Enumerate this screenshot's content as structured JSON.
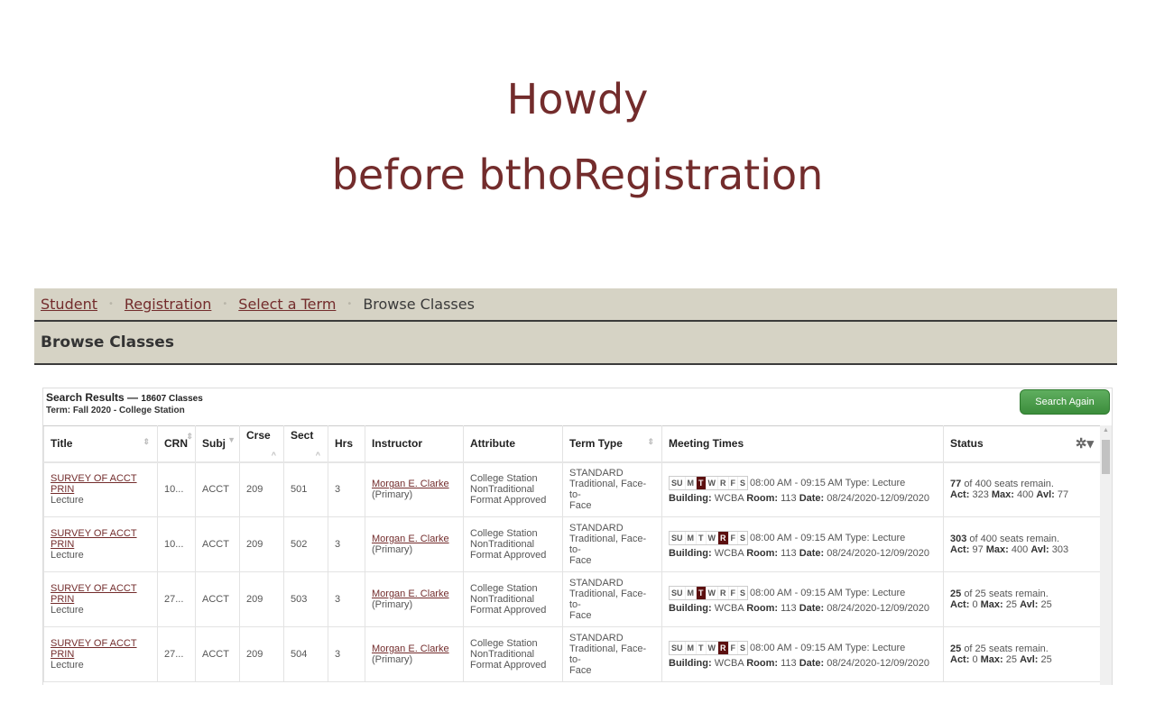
{
  "slide": {
    "line1": "Howdy",
    "line2": "before bthoRegistration"
  },
  "breadcrumb": {
    "items": [
      "Student",
      "Registration",
      "Select a Term"
    ],
    "current": "Browse Classes",
    "separator": "•"
  },
  "page_title": "Browse Classes",
  "results": {
    "title": "Search Results —",
    "count": "18607 Classes",
    "term": "Term: Fall 2020 - College Station",
    "search_again_label": "Search Again",
    "columns": [
      "Title",
      "CRN",
      "Subj",
      "Crse",
      "Sect",
      "Hrs",
      "Instructor",
      "Attribute",
      "Term Type",
      "Meeting Times",
      "Status"
    ],
    "settings_icon": "gear-icon",
    "rows": [
      {
        "title": "SURVEY OF ACCT PRIN",
        "schedule_type": "Lecture",
        "crn": "10...",
        "subj": "ACCT",
        "crse": "209",
        "sect": "501",
        "hrs": "3",
        "instructor": "Morgan E. Clarke",
        "instructor_role": "(Primary)",
        "attribute": [
          "College Station",
          "NonTraditional",
          "Format Approved"
        ],
        "term_type": [
          "STANDARD",
          "Traditional, Face-to-",
          "Face"
        ],
        "days": [
          {
            "l": "SU",
            "on": false
          },
          {
            "l": "M",
            "on": false
          },
          {
            "l": "T",
            "on": true
          },
          {
            "l": "W",
            "on": false
          },
          {
            "l": "R",
            "on": false
          },
          {
            "l": "F",
            "on": false
          },
          {
            "l": "S",
            "on": false
          }
        ],
        "time": "08:00 AM - 09:15 AM Type: Lecture",
        "building": "WCBA",
        "room": "113",
        "date": "08/24/2020-12/09/2020",
        "seats_remain": "77",
        "seats_of": "of 400 seats remain.",
        "act": "323",
        "max": "400",
        "avl": "77"
      },
      {
        "title": "SURVEY OF ACCT PRIN",
        "schedule_type": "Lecture",
        "crn": "10...",
        "subj": "ACCT",
        "crse": "209",
        "sect": "502",
        "hrs": "3",
        "instructor": "Morgan E. Clarke",
        "instructor_role": "(Primary)",
        "attribute": [
          "College Station",
          "NonTraditional",
          "Format Approved"
        ],
        "term_type": [
          "STANDARD",
          "Traditional, Face-to-",
          "Face"
        ],
        "days": [
          {
            "l": "SU",
            "on": false
          },
          {
            "l": "M",
            "on": false
          },
          {
            "l": "T",
            "on": false
          },
          {
            "l": "W",
            "on": false
          },
          {
            "l": "R",
            "on": true
          },
          {
            "l": "F",
            "on": false
          },
          {
            "l": "S",
            "on": false
          }
        ],
        "time": "08:00 AM - 09:15 AM Type: Lecture",
        "building": "WCBA",
        "room": "113",
        "date": "08/24/2020-12/09/2020",
        "seats_remain": "303",
        "seats_of": "of 400 seats remain.",
        "act": "97",
        "max": "400",
        "avl": "303"
      },
      {
        "title": "SURVEY OF ACCT PRIN",
        "schedule_type": "Lecture",
        "crn": "27...",
        "subj": "ACCT",
        "crse": "209",
        "sect": "503",
        "hrs": "3",
        "instructor": "Morgan E. Clarke",
        "instructor_role": "(Primary)",
        "attribute": [
          "College Station",
          "NonTraditional",
          "Format Approved"
        ],
        "term_type": [
          "STANDARD",
          "Traditional, Face-to-",
          "Face"
        ],
        "days": [
          {
            "l": "SU",
            "on": false
          },
          {
            "l": "M",
            "on": false
          },
          {
            "l": "T",
            "on": true
          },
          {
            "l": "W",
            "on": false
          },
          {
            "l": "R",
            "on": false
          },
          {
            "l": "F",
            "on": false
          },
          {
            "l": "S",
            "on": false
          }
        ],
        "time": "08:00 AM - 09:15 AM Type: Lecture",
        "building": "WCBA",
        "room": "113",
        "date": "08/24/2020-12/09/2020",
        "seats_remain": "25",
        "seats_of": "of 25 seats remain.",
        "act": "0",
        "max": "25",
        "avl": "25"
      },
      {
        "title": "SURVEY OF ACCT PRIN",
        "schedule_type": "Lecture",
        "crn": "27...",
        "subj": "ACCT",
        "crse": "209",
        "sect": "504",
        "hrs": "3",
        "instructor": "Morgan E. Clarke",
        "instructor_role": "(Primary)",
        "attribute": [
          "College Station",
          "NonTraditional",
          "Format Approved"
        ],
        "term_type": [
          "STANDARD",
          "Traditional, Face-to-",
          "Face"
        ],
        "days": [
          {
            "l": "SU",
            "on": false
          },
          {
            "l": "M",
            "on": false
          },
          {
            "l": "T",
            "on": false
          },
          {
            "l": "W",
            "on": false
          },
          {
            "l": "R",
            "on": true
          },
          {
            "l": "F",
            "on": false
          },
          {
            "l": "S",
            "on": false
          }
        ],
        "time": "08:00 AM - 09:15 AM Type: Lecture",
        "building": "WCBA",
        "room": "113",
        "date": "08/24/2020-12/09/2020",
        "seats_remain": "25",
        "seats_of": "of 25 seats remain.",
        "act": "0",
        "max": "25",
        "avl": "25"
      }
    ],
    "labels": {
      "building": "Building:",
      "room": "Room:",
      "date": "Date:",
      "act": "Act:",
      "max": "Max:",
      "avl": "Avl:"
    }
  },
  "colors": {
    "maroon": "#732c2c",
    "active_day": "#5c0f0f",
    "button_green": "#4a9e4a",
    "bar_bg": "#d6d3c5"
  }
}
